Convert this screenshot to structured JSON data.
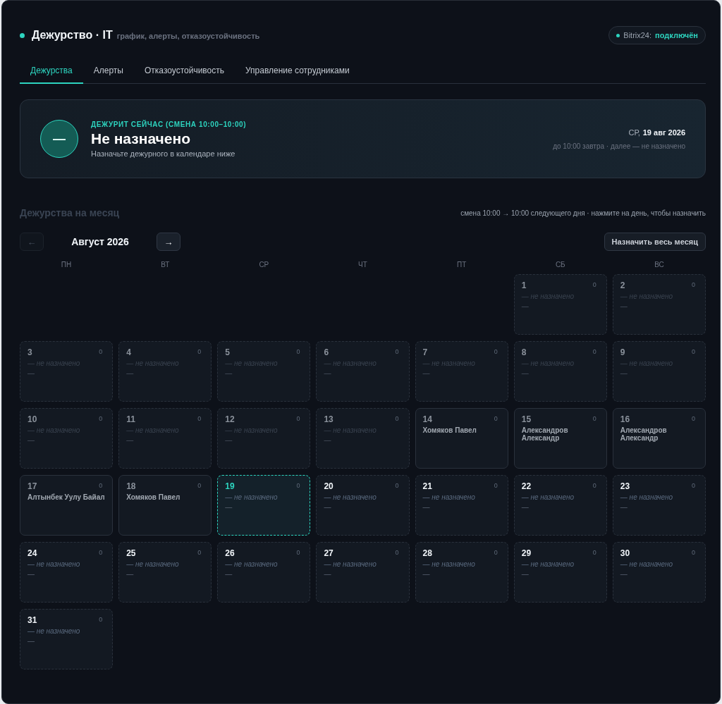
{
  "header": {
    "title": "Дежурство · IT",
    "subtitle": "график, алерты, отказоустойчивость",
    "integration": {
      "label": "Bitrix24:",
      "status": "подключён",
      "connected": true
    }
  },
  "tabs": [
    {
      "label": "Дежурства",
      "selected": true
    },
    {
      "label": "Алерты",
      "selected": false
    },
    {
      "label": "Отказоустойчивость",
      "selected": false
    },
    {
      "label": "Управление сотрудниками",
      "selected": false
    }
  ],
  "now_card": {
    "avatar": "—",
    "eyebrow": "ДЕЖУРИТ СЕЙЧАС (СМЕНА 10:00–10:00)",
    "name": "Не назначено",
    "hint": "Назначьте дежурного в календаре ниже",
    "weekday": "СР,",
    "date": "19 авг 2026",
    "next": "до 10:00 завтра · далее — не назначено"
  },
  "month": {
    "title": "Дежурства на месяц",
    "hint": "смена 10:00 → 10:00 следующего дня · нажмите на день, чтобы назначить",
    "prev": {
      "label": "←",
      "disabled": true
    },
    "label": "Август 2026",
    "next": {
      "label": "→",
      "disabled": false
    },
    "assign_all": "Назначить весь месяц",
    "weekdays": [
      "ПН",
      "ВТ",
      "СР",
      "ЧТ",
      "ПТ",
      "СБ",
      "ВС"
    ],
    "weeks": [
      {
        "days": [
          {
            "kind": "blank"
          },
          {
            "kind": "blank"
          },
          {
            "kind": "blank"
          },
          {
            "kind": "blank"
          },
          {
            "kind": "blank"
          },
          {
            "kind": "day",
            "day": "1",
            "count": "0",
            "assigned": false,
            "name": "— не назначено",
            "extra": "—",
            "past": true,
            "today": false
          },
          {
            "kind": "day",
            "day": "2",
            "count": "0",
            "assigned": false,
            "name": "— не назначено",
            "extra": "—",
            "past": true,
            "today": false
          }
        ]
      },
      {
        "days": [
          {
            "kind": "day",
            "day": "3",
            "count": "0",
            "assigned": false,
            "name": "— не назначено",
            "extra": "—",
            "past": true,
            "today": false
          },
          {
            "kind": "day",
            "day": "4",
            "count": "0",
            "assigned": false,
            "name": "— не назначено",
            "extra": "—",
            "past": true,
            "today": false
          },
          {
            "kind": "day",
            "day": "5",
            "count": "0",
            "assigned": false,
            "name": "— не назначено",
            "extra": "—",
            "past": true,
            "today": false
          },
          {
            "kind": "day",
            "day": "6",
            "count": "0",
            "assigned": false,
            "name": "— не назначено",
            "extra": "—",
            "past": true,
            "today": false
          },
          {
            "kind": "day",
            "day": "7",
            "count": "0",
            "assigned": false,
            "name": "— не назначено",
            "extra": "—",
            "past": true,
            "today": false
          },
          {
            "kind": "day",
            "day": "8",
            "count": "0",
            "assigned": false,
            "name": "— не назначено",
            "extra": "—",
            "past": true,
            "today": false
          },
          {
            "kind": "day",
            "day": "9",
            "count": "0",
            "assigned": false,
            "name": "— не назначено",
            "extra": "—",
            "past": true,
            "today": false
          }
        ]
      },
      {
        "days": [
          {
            "kind": "day",
            "day": "10",
            "count": "0",
            "assigned": false,
            "name": "— не назначено",
            "extra": "—",
            "past": true,
            "today": false
          },
          {
            "kind": "day",
            "day": "11",
            "count": "0",
            "assigned": false,
            "name": "— не назначено",
            "extra": "—",
            "past": true,
            "today": false
          },
          {
            "kind": "day",
            "day": "12",
            "count": "0",
            "assigned": false,
            "name": "— не назначено",
            "extra": "—",
            "past": true,
            "today": false
          },
          {
            "kind": "day",
            "day": "13",
            "count": "0",
            "assigned": false,
            "name": "— не назначено",
            "extra": "—",
            "past": true,
            "today": false
          },
          {
            "kind": "day",
            "day": "14",
            "count": "0",
            "assigned": true,
            "name": "Хомяков Павел",
            "past": true,
            "today": false
          },
          {
            "kind": "day",
            "day": "15",
            "count": "0",
            "assigned": true,
            "name": "Александров Александр",
            "past": true,
            "today": false
          },
          {
            "kind": "day",
            "day": "16",
            "count": "0",
            "assigned": true,
            "name": "Александров Александр",
            "past": true,
            "today": false
          }
        ]
      },
      {
        "days": [
          {
            "kind": "day",
            "day": "17",
            "count": "0",
            "assigned": true,
            "name": "Алтынбек Уулу Байал",
            "past": true,
            "today": false
          },
          {
            "kind": "day",
            "day": "18",
            "count": "0",
            "assigned": true,
            "name": "Хомяков Павел",
            "past": true,
            "today": false
          },
          {
            "kind": "day",
            "day": "19",
            "count": "0",
            "assigned": false,
            "name": "— не назначено",
            "extra": "—",
            "past": false,
            "today": true
          },
          {
            "kind": "day",
            "day": "20",
            "count": "0",
            "assigned": false,
            "name": "— не назначено",
            "extra": "—",
            "past": false,
            "today": false
          },
          {
            "kind": "day",
            "day": "21",
            "count": "0",
            "assigned": false,
            "name": "— не назначено",
            "extra": "—",
            "past": false,
            "today": false
          },
          {
            "kind": "day",
            "day": "22",
            "count": "0",
            "assigned": false,
            "name": "— не назначено",
            "extra": "—",
            "past": false,
            "today": false
          },
          {
            "kind": "day",
            "day": "23",
            "count": "0",
            "assigned": false,
            "name": "— не назначено",
            "extra": "—",
            "past": false,
            "today": false
          }
        ]
      },
      {
        "days": [
          {
            "kind": "day",
            "day": "24",
            "count": "0",
            "assigned": false,
            "name": "— не назначено",
            "extra": "—",
            "past": false,
            "today": false
          },
          {
            "kind": "day",
            "day": "25",
            "count": "0",
            "assigned": false,
            "name": "— не назначено",
            "extra": "—",
            "past": false,
            "today": false
          },
          {
            "kind": "day",
            "day": "26",
            "count": "0",
            "assigned": false,
            "name": "— не назначено",
            "extra": "—",
            "past": false,
            "today": false
          },
          {
            "kind": "day",
            "day": "27",
            "count": "0",
            "assigned": false,
            "name": "— не назначено",
            "extra": "—",
            "past": false,
            "today": false
          },
          {
            "kind": "day",
            "day": "28",
            "count": "0",
            "assigned": false,
            "name": "— не назначено",
            "extra": "—",
            "past": false,
            "today": false
          },
          {
            "kind": "day",
            "day": "29",
            "count": "0",
            "assigned": false,
            "name": "— не назначено",
            "extra": "—",
            "past": false,
            "today": false
          },
          {
            "kind": "day",
            "day": "30",
            "count": "0",
            "assigned": false,
            "name": "— не назначено",
            "extra": "—",
            "past": false,
            "today": false
          }
        ]
      },
      {
        "days": [
          {
            "kind": "day",
            "day": "31",
            "count": "0",
            "assigned": false,
            "name": "— не назначено",
            "extra": "—",
            "past": false,
            "today": false
          },
          {
            "kind": "blank"
          },
          {
            "kind": "blank"
          },
          {
            "kind": "blank"
          },
          {
            "kind": "blank"
          },
          {
            "kind": "blank"
          },
          {
            "kind": "blank"
          }
        ]
      }
    ]
  }
}
